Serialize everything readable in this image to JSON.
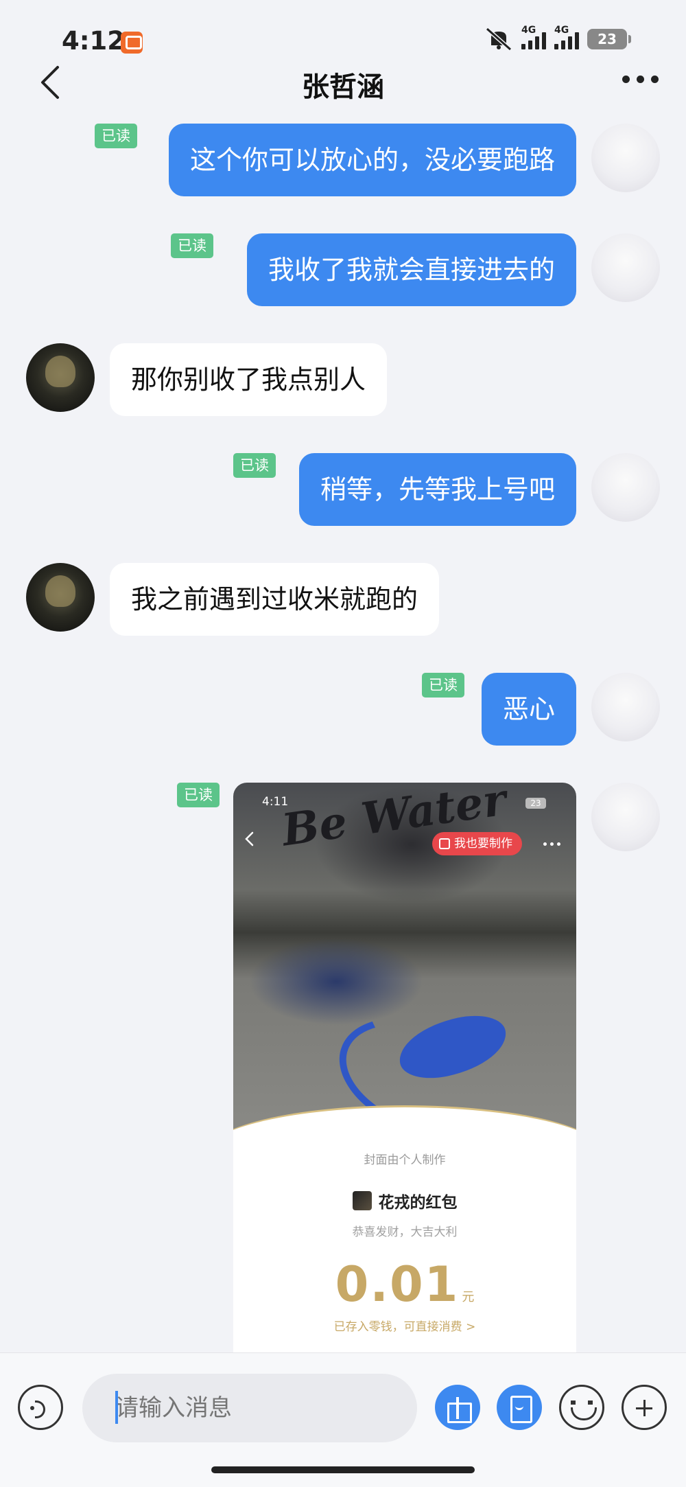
{
  "status_bar": {
    "time": "4:12",
    "network_1": "4G",
    "network_2": "4G",
    "battery": "23"
  },
  "header": {
    "title": "张哲涵"
  },
  "messages": [
    {
      "from": "me",
      "text": "这个你可以放心的，没必要跑路",
      "read": "已读"
    },
    {
      "from": "me",
      "text": "我收了我就会直接进去的",
      "read": "已读"
    },
    {
      "from": "them",
      "text": "那你别收了我点别人"
    },
    {
      "from": "me",
      "text": "稍等，先等我上号吧",
      "read": "已读"
    },
    {
      "from": "them",
      "text": "我之前遇到过收米就跑的"
    },
    {
      "from": "me",
      "text": "恶心",
      "read": "已读"
    }
  ],
  "red_packet_card": {
    "read": "已读",
    "status_time": "4:11",
    "status_battery": "23",
    "graffiti": "Be Water",
    "make_button": "我也要制作",
    "cover_caption": "封面由个人制作",
    "title": "花戎的红包",
    "subtitle": "恭喜发财，大吉大利",
    "amount": "0.01",
    "unit": "元",
    "stored_note": "已存入零钱，可直接消费 >"
  },
  "input_bar": {
    "placeholder": "请输入消息"
  },
  "colors": {
    "my_bubble": "#3d89f0",
    "read_badge": "#5cc48a",
    "background": "#f2f3f7",
    "amount_gold": "#c7a866"
  }
}
